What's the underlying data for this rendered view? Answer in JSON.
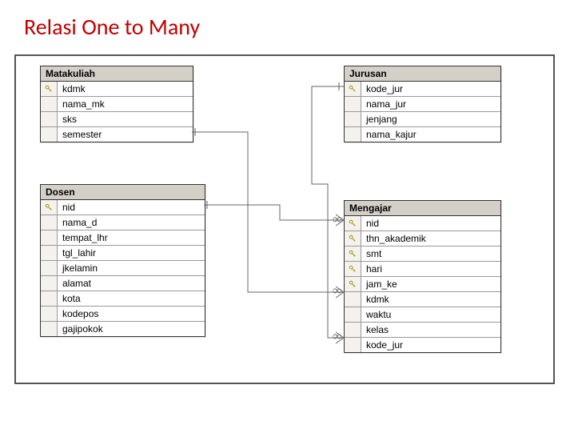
{
  "title": "Relasi One to Many",
  "tables": {
    "matakuliah": {
      "name": "Matakuliah",
      "fields": [
        {
          "key": true,
          "name": "kdmk"
        },
        {
          "key": false,
          "name": "nama_mk"
        },
        {
          "key": false,
          "name": "sks"
        },
        {
          "key": false,
          "name": "semester"
        }
      ]
    },
    "jurusan": {
      "name": "Jurusan",
      "fields": [
        {
          "key": true,
          "name": "kode_jur"
        },
        {
          "key": false,
          "name": "nama_jur"
        },
        {
          "key": false,
          "name": "jenjang"
        },
        {
          "key": false,
          "name": "nama_kajur"
        }
      ]
    },
    "dosen": {
      "name": "Dosen",
      "fields": [
        {
          "key": true,
          "name": "nid"
        },
        {
          "key": false,
          "name": "nama_d"
        },
        {
          "key": false,
          "name": "tempat_lhr"
        },
        {
          "key": false,
          "name": "tgl_lahir"
        },
        {
          "key": false,
          "name": "jkelamin"
        },
        {
          "key": false,
          "name": "alamat"
        },
        {
          "key": false,
          "name": "kota"
        },
        {
          "key": false,
          "name": "kodepos"
        },
        {
          "key": false,
          "name": "gajipokok"
        }
      ]
    },
    "mengajar": {
      "name": "Mengajar",
      "fields": [
        {
          "key": true,
          "name": "nid"
        },
        {
          "key": true,
          "name": "thn_akademik"
        },
        {
          "key": true,
          "name": "smt"
        },
        {
          "key": true,
          "name": "hari"
        },
        {
          "key": true,
          "name": "jam_ke"
        },
        {
          "key": false,
          "name": "kdmk"
        },
        {
          "key": false,
          "name": "waktu"
        },
        {
          "key": false,
          "name": "kelas"
        },
        {
          "key": false,
          "name": "kode_jur"
        }
      ]
    }
  },
  "symbols": {
    "infinity": "∞"
  }
}
